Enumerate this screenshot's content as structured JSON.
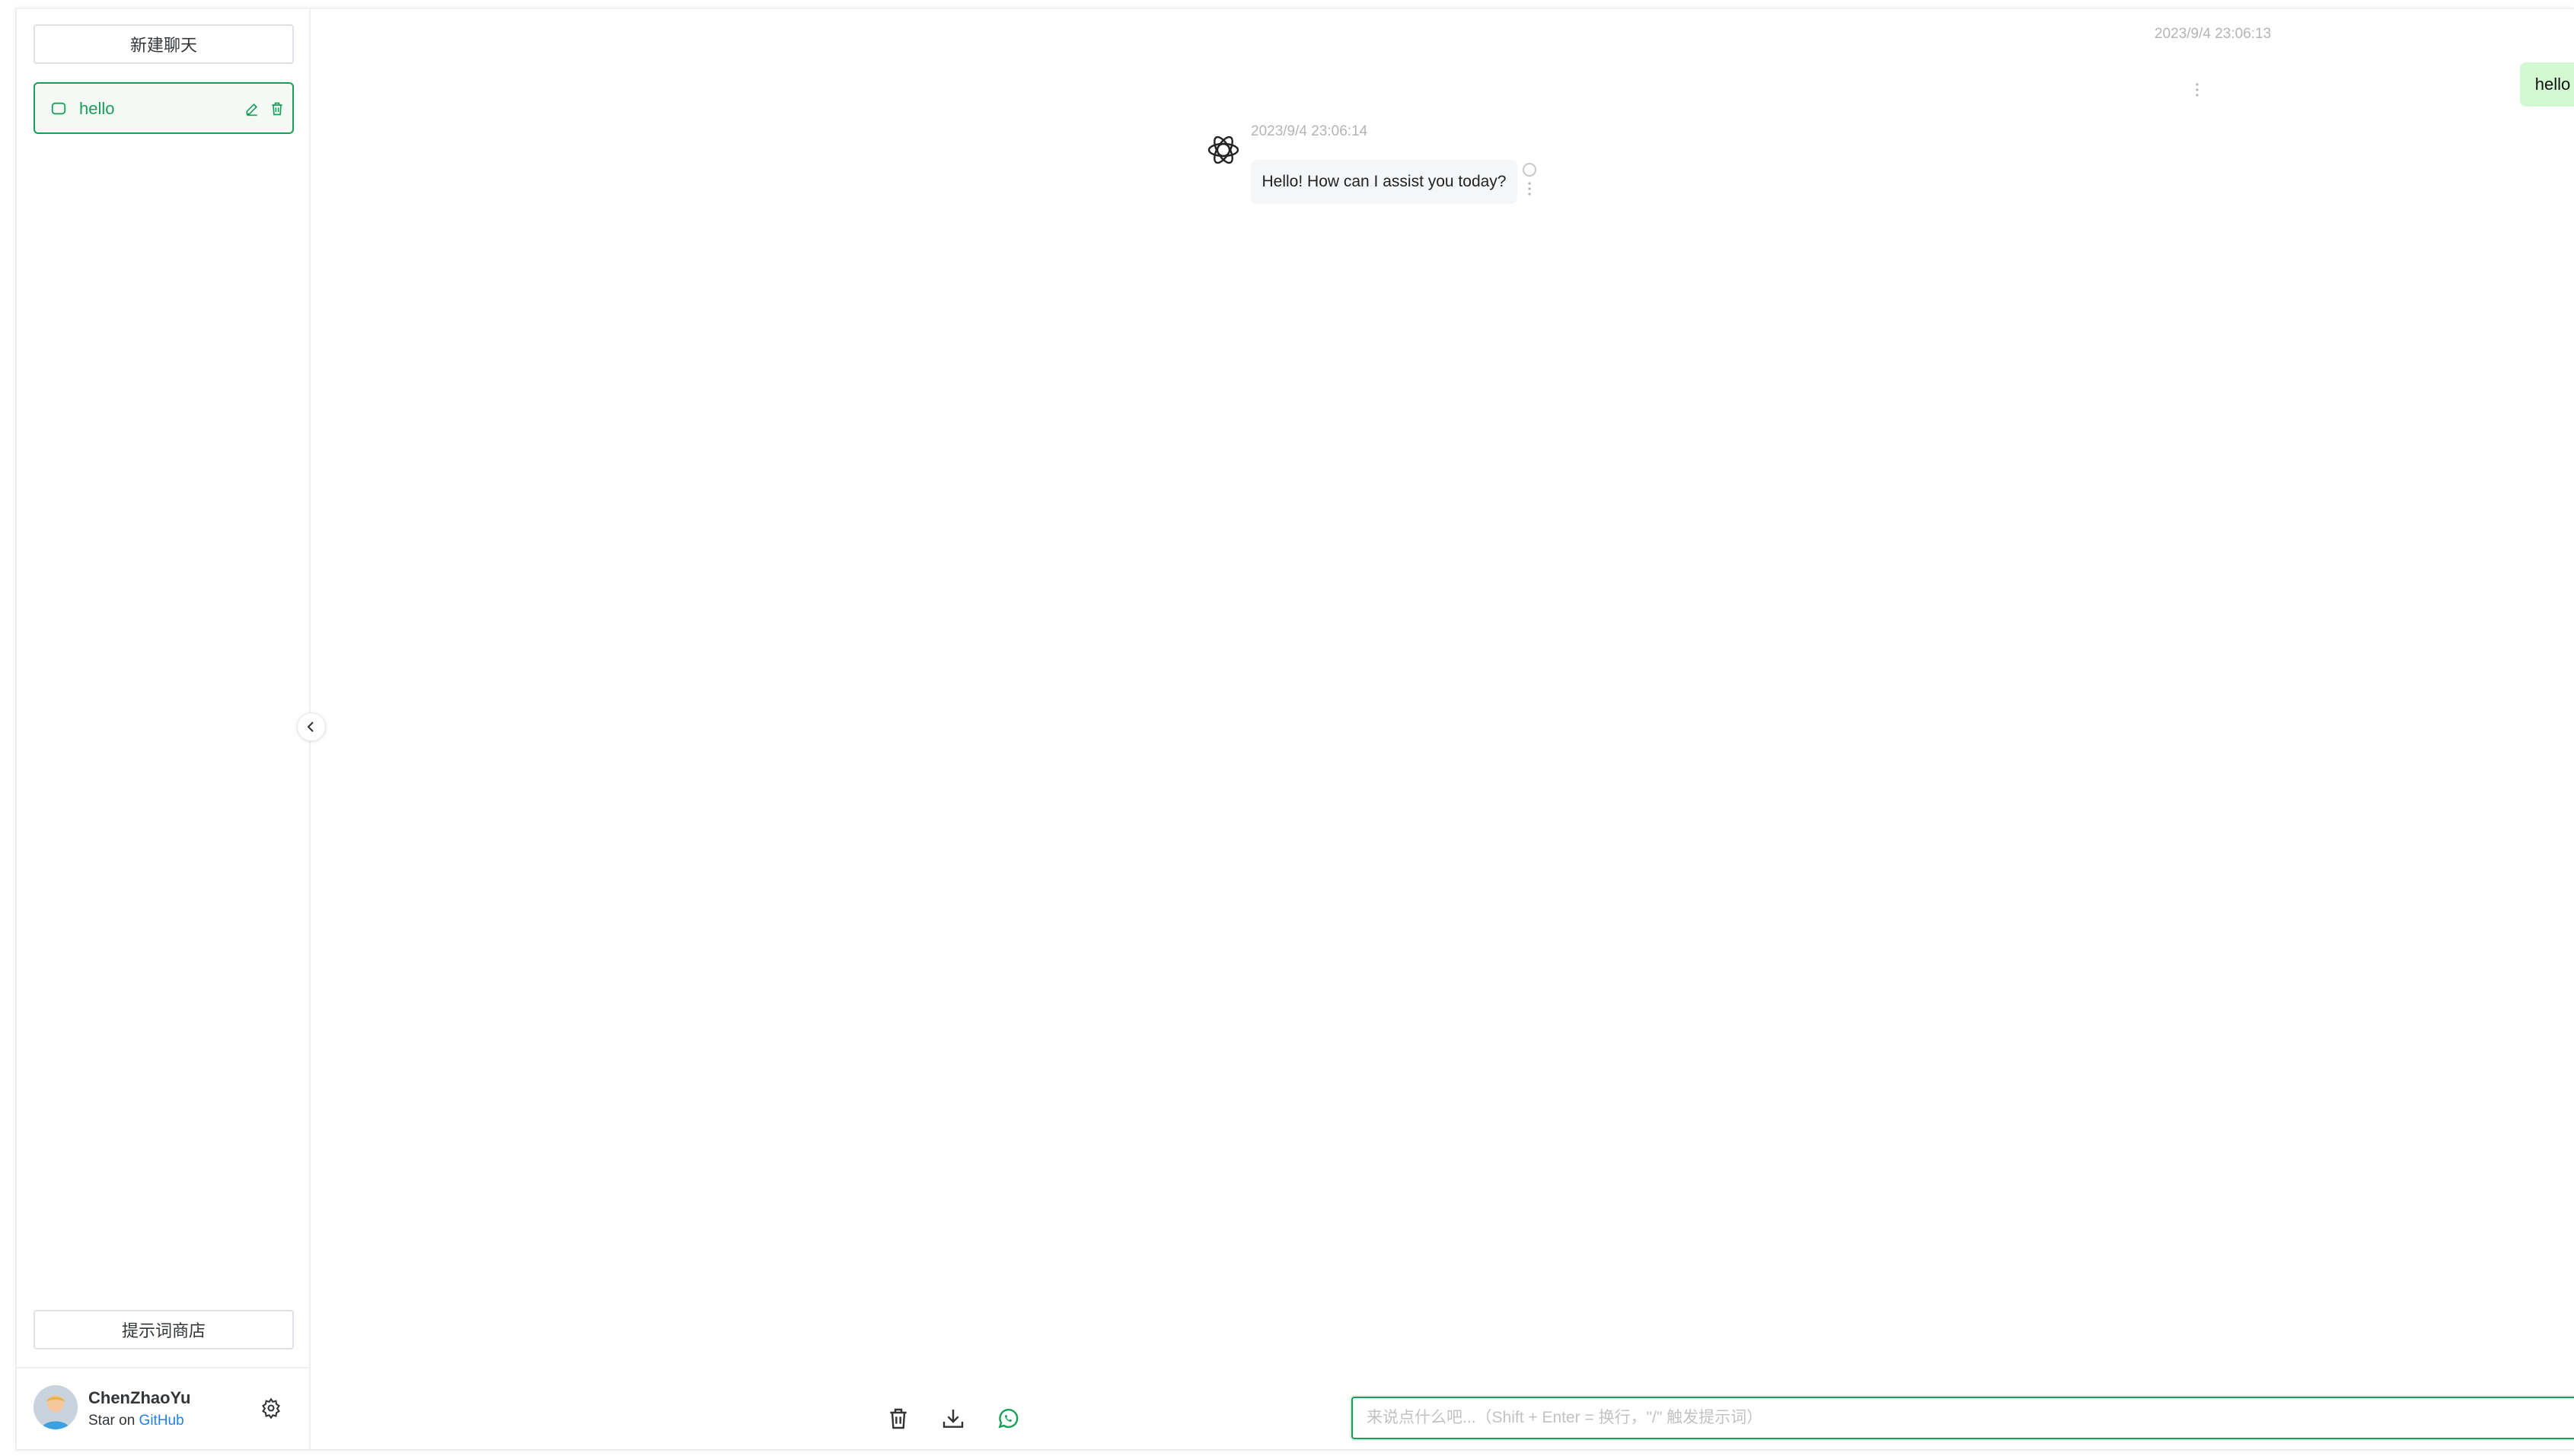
{
  "sidebar": {
    "new_chat_label": "新建聊天",
    "chat_items": [
      {
        "title": "hello"
      }
    ],
    "prompt_store_label": "提示词商店",
    "user": {
      "name": "ChenZhaoYu",
      "sub_prefix": "Star on",
      "sub_link": "GitHub"
    }
  },
  "messages": [
    {
      "role": "user",
      "timestamp": "2023/9/4 23:06:13",
      "text": "hello"
    },
    {
      "role": "assistant",
      "timestamp": "2023/9/4 23:06:14",
      "text": "Hello! How can I assist you today?"
    }
  ],
  "input": {
    "placeholder": "来说点什么吧...（Shift + Enter = 换行，\"/\" 触发提示词）",
    "value": ""
  },
  "colors": {
    "accent": "#18a058",
    "user_bubble": "#d2f9d1",
    "bot_bubble": "#f4f6f8",
    "send_button": "#8fd4ad",
    "link": "#2080f0"
  },
  "icons": {
    "chat_item": "message-icon",
    "edit": "edit-icon",
    "delete": "trash-icon",
    "settings": "gear-icon",
    "collapse": "chevron-left-icon",
    "clear": "trash-icon",
    "download": "download-icon",
    "context": "whatsapp-icon",
    "send": "send-icon",
    "bot": "openai-logo-icon"
  }
}
